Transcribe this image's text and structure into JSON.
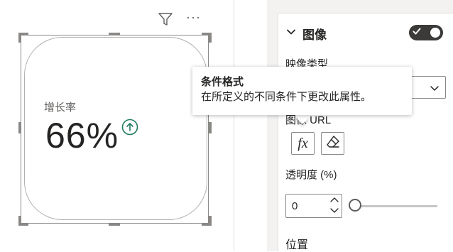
{
  "visual": {
    "kpi_label": "增长率",
    "kpi_value": "66%",
    "kpi_trend_icon": "arrow-up-circle-icon",
    "header_icons": [
      "filter-icon",
      "more-options-icon"
    ],
    "more_options_glyph": "···"
  },
  "format_pane": {
    "section_title": "图像",
    "section_toggle": "on",
    "image_type_label": "映像类型",
    "image_url_label": "图像 URL",
    "fx_button_label": "fx",
    "clear_button_icon": "eraser-icon",
    "transparency_label": "透明度 (%)",
    "transparency_value": "0",
    "position_label": "位置"
  },
  "tooltip": {
    "title": "条件格式",
    "body": "在所定义的不同条件下更改此属性。"
  },
  "colors": {
    "accent_green": "#1e7b5f",
    "toggle_dark": "#3b3a39",
    "gutter": "#f3f2f1",
    "border": "#8a8886"
  }
}
